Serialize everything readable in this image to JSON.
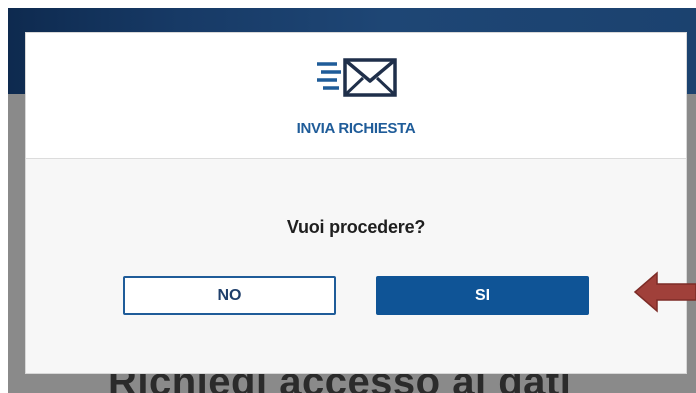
{
  "backdrop": {
    "page_heading": "Richiedi accesso ai dati"
  },
  "modal": {
    "icon": "send-envelope-icon",
    "title": "INVIA RICHIESTA",
    "question": "Vuoi procedere?",
    "no_label": "NO",
    "si_label": "SI"
  },
  "annotation": {
    "icon": "left-arrow-icon",
    "color": "#a0403a"
  },
  "colors": {
    "primary": "#0f5496",
    "title_blue": "#1f5c99",
    "header_bg": "#173a66"
  }
}
